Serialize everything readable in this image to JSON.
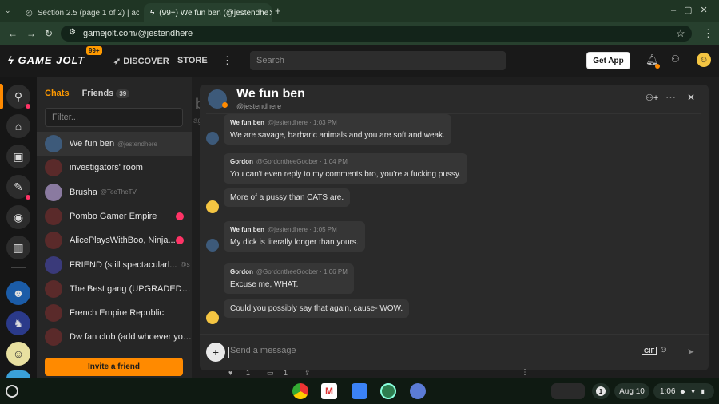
{
  "browser": {
    "tabs": [
      {
        "label": "Section 2.5 (page 1 of 2) | ace"
      },
      {
        "label": "(99+) We fun ben (@jestendhe"
      }
    ],
    "url": "gamejolt.com/@jestendhere"
  },
  "site": {
    "logo": "GAME JOLT",
    "notif_badge": "99+",
    "nav": [
      "DISCOVER",
      "STORE"
    ],
    "search_placeholder": "Search",
    "get_app": "Get App"
  },
  "sidebar": {
    "tab_chats": "Chats",
    "tab_friends": "Friends",
    "friends_count": "39",
    "filter_placeholder": "Filter...",
    "chats": [
      {
        "name": "We fun ben",
        "sub": "@jestendhere",
        "unread": false,
        "color": "#3d5a7a"
      },
      {
        "name": "investigators' room",
        "sub": "",
        "unread": false,
        "color": "#5a2a2a"
      },
      {
        "name": "Brusha",
        "sub": "@TeeTheTV",
        "unread": false,
        "color": "#8a7aa0"
      },
      {
        "name": "Pombo Gamer Empire",
        "sub": "",
        "unread": true,
        "color": "#5a2a2a"
      },
      {
        "name": "AlicePlaysWithBoo, Ninja...",
        "sub": "",
        "unread": true,
        "color": "#5a2a2a"
      },
      {
        "name": "FRIEND (still spectacularl...",
        "sub": "@s",
        "unread": false,
        "color": "#3a3a7a"
      },
      {
        "name": "The Best gang (UPGRADED) ...",
        "sub": "",
        "unread": false,
        "color": "#5a2a2a"
      },
      {
        "name": "French Empire Republic",
        "sub": "",
        "unread": false,
        "color": "#5a2a2a"
      },
      {
        "name": "Dw fan club (add whoever you...",
        "sub": "",
        "unread": false,
        "color": "#5a2a2a"
      }
    ],
    "invite": "Invite a friend"
  },
  "chat": {
    "title": "We fun ben",
    "username": "@jestendhere",
    "messages": [
      {
        "author": "We fun ben",
        "handle": "@jestendhere",
        "time": "1:03 PM",
        "text": "We are savage, barbaric animals and you are soft and weak.",
        "avatar": "ben"
      },
      {
        "author": "Gordon",
        "handle": "@GordontheeGoober",
        "time": "1:04 PM",
        "text": "You can't even reply to my comments bro, you're a fucking pussy.",
        "avatar": "none"
      },
      {
        "author": "",
        "handle": "",
        "time": "",
        "text": "More of a pussy than CATS are.",
        "avatar": "gordon"
      },
      {
        "author": "We fun ben",
        "handle": "@jestendhere",
        "time": "1:05 PM",
        "text": "My dick is literally longer than yours.",
        "avatar": "ben"
      },
      {
        "author": "Gordon",
        "handle": "@GordontheeGoober",
        "time": "1:06 PM",
        "text": "Excuse me, WHAT.",
        "avatar": "none"
      },
      {
        "author": "",
        "handle": "",
        "time": "",
        "text": "Could you possibly say that again, cause- WOW.",
        "avatar": "gordon"
      }
    ],
    "composer_placeholder": "Send a message",
    "gif_label": "GIF"
  },
  "bottom_counts": [
    "1",
    "1"
  ],
  "taskbar": {
    "date": "Aug 10",
    "time": "1:06",
    "notif_count": "1"
  },
  "colors": {
    "accent": "#ff8a00",
    "unread": "#ff3366"
  }
}
